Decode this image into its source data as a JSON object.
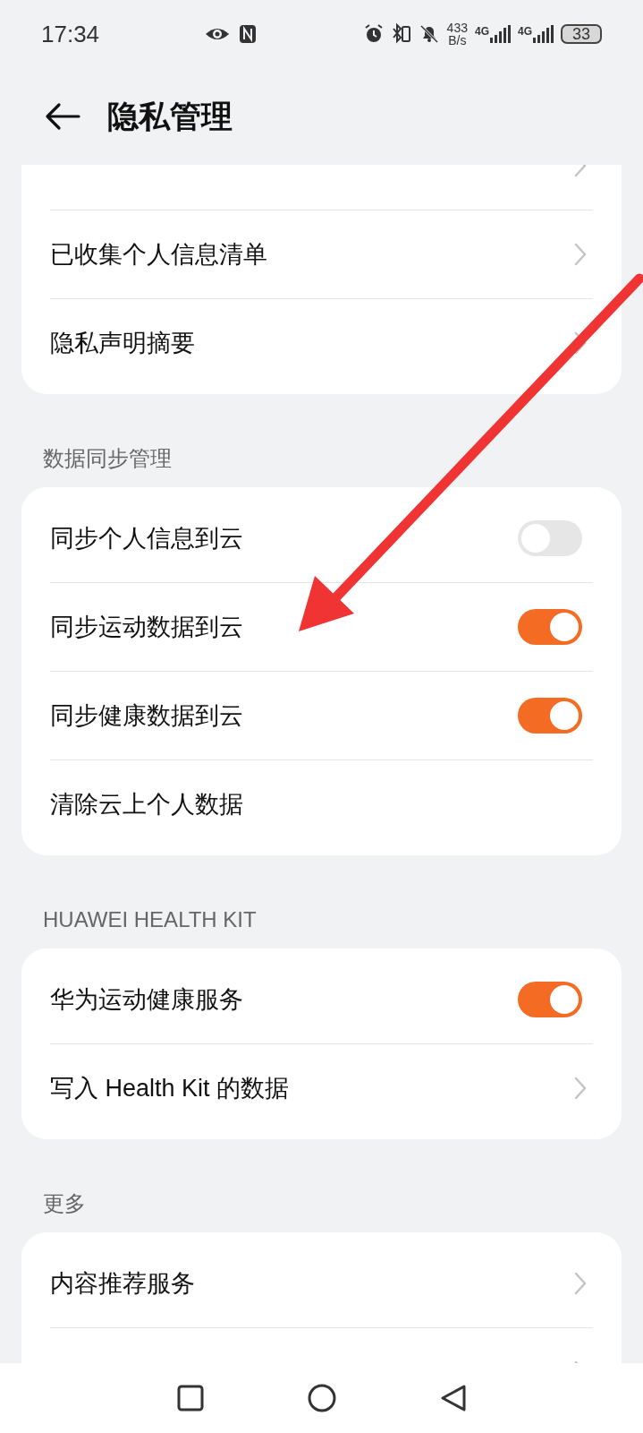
{
  "status_bar": {
    "time": "17:34",
    "speed_value": "433",
    "speed_unit": "B/s",
    "sim1_label": "4G",
    "sim2_label": "4G",
    "battery": "33"
  },
  "header": {
    "title": "隐私管理"
  },
  "sections": [
    {
      "items": [
        {
          "kind": "link"
        },
        {
          "kind": "link",
          "label": "已收集个人信息清单"
        },
        {
          "kind": "link",
          "label": "隐私声明摘要"
        }
      ]
    },
    {
      "title": "数据同步管理",
      "items": [
        {
          "kind": "toggle",
          "label": "同步个人信息到云",
          "on": false
        },
        {
          "kind": "toggle",
          "label": "同步运动数据到云",
          "on": true
        },
        {
          "kind": "toggle",
          "label": "同步健康数据到云",
          "on": true
        },
        {
          "kind": "plain",
          "label": "清除云上个人数据"
        }
      ]
    },
    {
      "title": "HUAWEI HEALTH KIT",
      "items": [
        {
          "kind": "toggle",
          "label": "华为运动健康服务",
          "on": true
        },
        {
          "kind": "link",
          "label": "写入 Health Kit 的数据"
        }
      ]
    },
    {
      "title": "更多",
      "items": [
        {
          "kind": "link",
          "label": "内容推荐服务"
        },
        {
          "kind": "link"
        }
      ]
    }
  ]
}
